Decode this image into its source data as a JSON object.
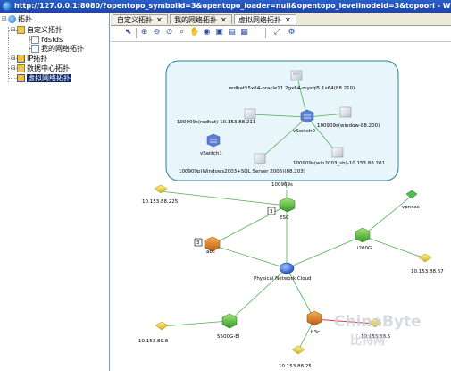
{
  "window": {
    "title": "http://127.0.0.1:8080/?opentopo_symbolid=3&opentopo_loader=null&opentopo_levelInodeid=3&topoori - Windo"
  },
  "tree": {
    "root": "拓扑",
    "items": [
      {
        "label": "自定义拓扑"
      },
      {
        "label": "fdsfds"
      },
      {
        "label": "我的网络拓扑"
      },
      {
        "label": "IP拓扑"
      },
      {
        "label": "数据中心拓扑"
      },
      {
        "label": "虚拟网络拓扑"
      }
    ]
  },
  "tabs": [
    {
      "label": "自定义拓扑",
      "close": "✕"
    },
    {
      "label": "我的网络拓扑",
      "close": "✕"
    },
    {
      "label": "虚拟网络拓扑",
      "close": "✕"
    }
  ],
  "toolbar": {
    "icons": [
      "pointer-icon",
      "zoom-in-icon",
      "zoom-out-icon",
      "zoom-fit-icon",
      "zoom-region-icon",
      "hand-pan-icon",
      "eye-icon",
      "save-icon",
      "export-icon",
      "layout-icon",
      "fullscreen-icon",
      "settings-icon"
    ]
  },
  "topology": {
    "cluster_nodes": {
      "redhat_oracle": "redhat55x64-oracle11.2gx64-mysql5.1x64(88.210)",
      "redhat": "100909s(redhat)-10.153.88.211",
      "window": "100909s(window-88.200)",
      "vswitch0": "vSwitch0",
      "vswitch1": "vSwitch1",
      "win2003": "100909s(win2003_sh)-10.153.88.201",
      "win2003sql": "100909p(Windows2003+SQL Server 2005)(88.203)"
    },
    "host_label": "100909s",
    "nodes": {
      "n225": "10.153.88.225",
      "esc": "ESC",
      "esc_badge": "3",
      "abc": "abc",
      "abc_badge": "3",
      "vpnnsx": "vpnnsx",
      "n2006": "i200G",
      "n67": "10.153.88.67",
      "cloud": "Physical Network Cloud",
      "n89": "10.153.89.8",
      "n5500": "5500G-EI",
      "h3c": "h3c",
      "n88_5": "10.153.88.5",
      "n88_25": "10.153.88.25"
    },
    "colors": {
      "link": "#4caf50",
      "link_alert": "#e53935",
      "cluster_fill": "#e8f5fa",
      "cluster_border": "#2a7fa0"
    }
  },
  "watermark": {
    "brand": "ChinaByte",
    "sub": "比特网"
  }
}
